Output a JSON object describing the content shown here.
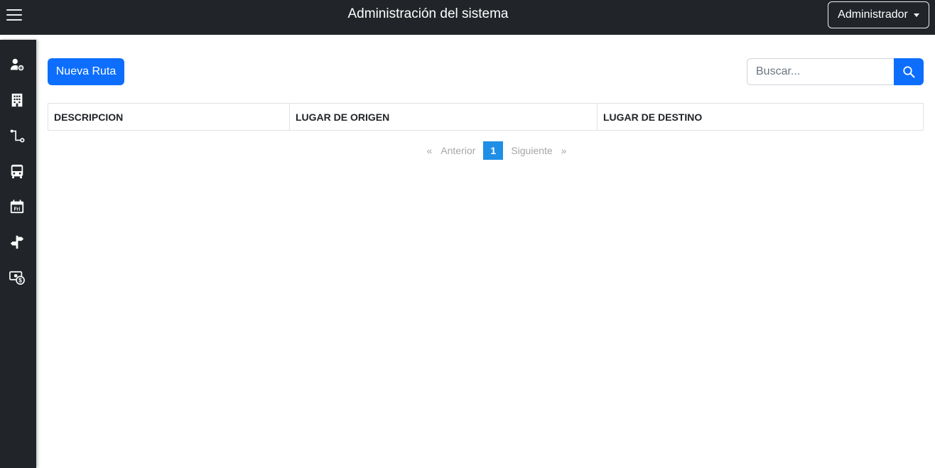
{
  "header": {
    "title": "Administración del sistema",
    "user_menu_label": "Administrador"
  },
  "sidebar": {
    "items": [
      {
        "icon": "user-gear-icon"
      },
      {
        "icon": "building-icon"
      },
      {
        "icon": "route-icon"
      },
      {
        "icon": "bus-icon"
      },
      {
        "icon": "calendar-day-icon",
        "label": "Fri"
      },
      {
        "icon": "signpost-icon"
      },
      {
        "icon": "money-icon"
      }
    ]
  },
  "toolbar": {
    "new_button_label": "Nueva Ruta",
    "search_placeholder": "Buscar..."
  },
  "table": {
    "columns": [
      "DESCRIPCION",
      "LUGAR DE ORIGEN",
      "LUGAR DE DESTINO"
    ],
    "rows": []
  },
  "pagination": {
    "first": "«",
    "prev": "Anterior",
    "current_page": "1",
    "next": "Siguiente",
    "last": "»"
  },
  "colors": {
    "primary": "#0d6efd",
    "dark": "#212529",
    "active_page": "#1f8fe6"
  }
}
